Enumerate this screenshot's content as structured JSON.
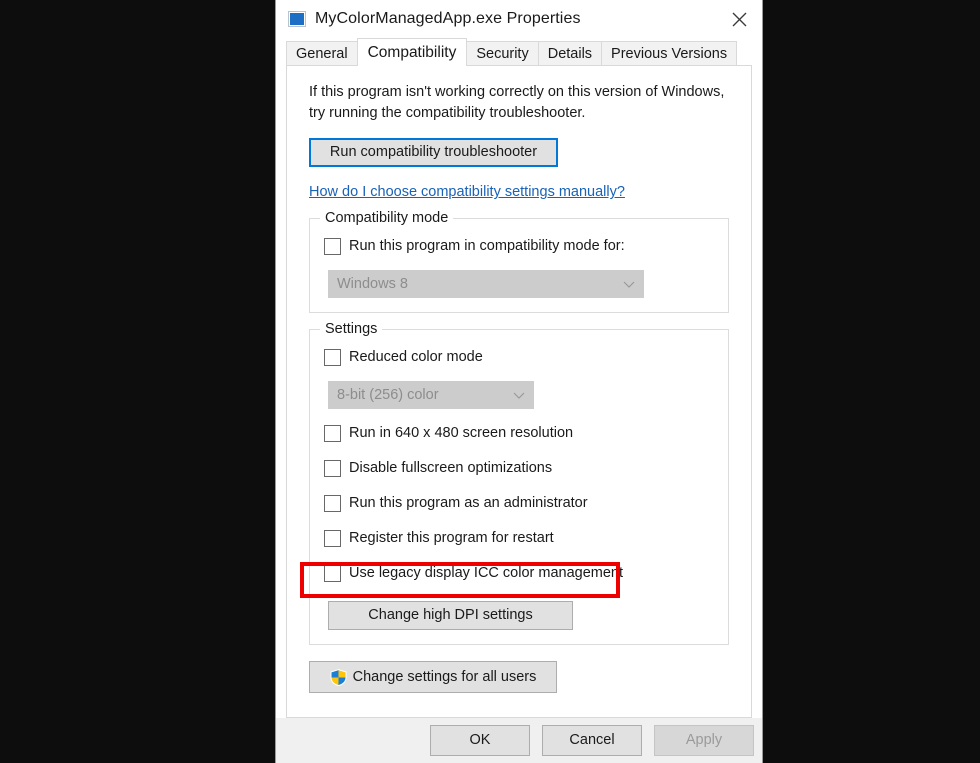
{
  "window": {
    "title": "MyColorManagedApp.exe Properties",
    "app_icon": "application-icon",
    "close_label": "Close"
  },
  "tabs": [
    {
      "label": "General",
      "active": false
    },
    {
      "label": "Compatibility",
      "active": true
    },
    {
      "label": "Security",
      "active": false
    },
    {
      "label": "Details",
      "active": false
    },
    {
      "label": "Previous Versions",
      "active": false
    }
  ],
  "panel": {
    "intro": "If this program isn't working correctly on this version of Windows, try running the compatibility troubleshooter.",
    "troubleshoot_button": "Run compatibility troubleshooter",
    "help_link": "How do I choose compatibility settings manually?"
  },
  "compatibility_mode": {
    "legend": "Compatibility mode",
    "checkbox_label": "Run this program in compatibility mode for:",
    "checkbox_checked": false,
    "combo_value": "Windows 8",
    "combo_disabled": true
  },
  "settings": {
    "legend": "Settings",
    "reduced_color_label": "Reduced color mode",
    "reduced_color_checked": false,
    "color_depth_value": "8-bit (256) color",
    "color_depth_disabled": true,
    "checkboxes": [
      {
        "label": "Run in 640 x 480 screen resolution",
        "checked": false,
        "highlighted": false
      },
      {
        "label": "Disable fullscreen optimizations",
        "checked": false,
        "highlighted": false
      },
      {
        "label": "Run this program as an administrator",
        "checked": false,
        "highlighted": false
      },
      {
        "label": "Register this program for restart",
        "checked": false,
        "highlighted": false
      },
      {
        "label": "Use legacy display ICC color management",
        "checked": false,
        "highlighted": true
      }
    ],
    "dpi_button": "Change high DPI settings"
  },
  "all_users_button": {
    "label": "Change settings for all users",
    "icon": "uac-shield-icon"
  },
  "footer": {
    "ok": "OK",
    "cancel": "Cancel",
    "apply": "Apply",
    "apply_disabled": true
  },
  "colors": {
    "accent_blue": "#0078d7",
    "link_blue": "#1962b7",
    "highlight_red": "#ee0000",
    "shield_blue": "#1c7fd3",
    "shield_yellow": "#ffc40c",
    "page_background": "#0d0d0d",
    "footer_background": "#f0f0f0"
  }
}
